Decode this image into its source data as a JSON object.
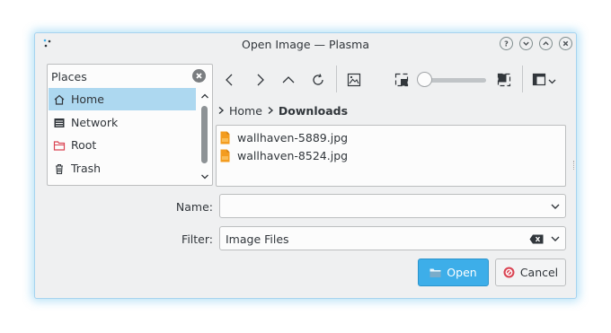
{
  "window": {
    "title": "Open Image — Plasma",
    "titlebar_buttons": [
      "help-icon",
      "minimize-icon",
      "maximize-icon",
      "close-icon"
    ]
  },
  "places": {
    "title": "Places",
    "items": [
      {
        "label": "Home",
        "icon": "home-icon",
        "selected": true
      },
      {
        "label": "Network",
        "icon": "network-icon",
        "selected": false
      },
      {
        "label": "Root",
        "icon": "folder-red-icon",
        "selected": false
      },
      {
        "label": "Trash",
        "icon": "trash-icon",
        "selected": false
      }
    ]
  },
  "toolbar": {
    "tools": [
      "back-icon",
      "forward-icon",
      "up-icon",
      "reload-icon",
      "preview-icon",
      "zoom-out-icon",
      "zoom-in-icon",
      "view-options-icon"
    ],
    "zoom_level": 0.0
  },
  "breadcrumb": {
    "items": [
      "Home",
      "Downloads"
    ]
  },
  "files": [
    {
      "name": "wallhaven-5889.jpg",
      "icon": "image-file-icon"
    },
    {
      "name": "wallhaven-8524.jpg",
      "icon": "image-file-icon"
    }
  ],
  "form": {
    "name_label": "Name:",
    "name_value": "",
    "filter_label": "Filter:",
    "filter_value": "Image Files"
  },
  "buttons": {
    "open_label": "Open",
    "cancel_label": "Cancel"
  },
  "colors": {
    "accent": "#3daee9",
    "selection": "#add8f0",
    "file_icon": "#f39c1f",
    "cancel_icon": "#da4453"
  }
}
